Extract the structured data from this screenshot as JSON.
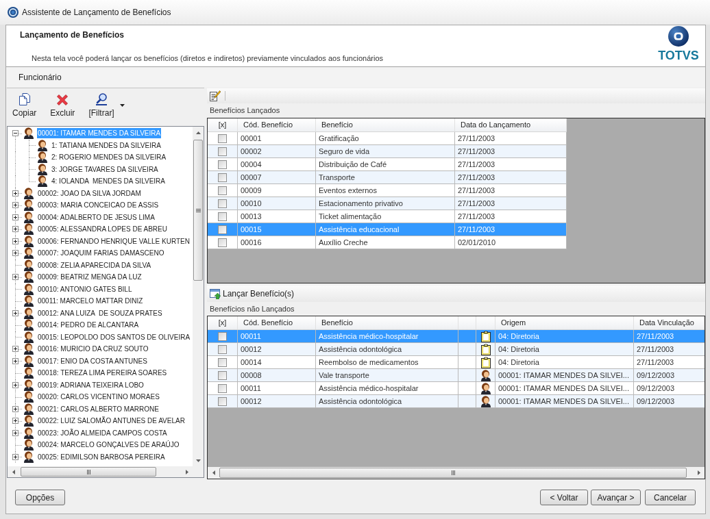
{
  "window": {
    "title": "Assistente de Lançamento de Benefícios"
  },
  "header": {
    "title": "Lançamento de Benefícios",
    "description": "Nesta tela você poderá lançar os benefícios (diretos e indiretos) previamente vinculados aos funcionários",
    "logo_text": "TOTVS"
  },
  "section": {
    "title": "Funcionário"
  },
  "employee_toolbar": {
    "buttons": [
      {
        "kind": "copy",
        "label": "Copiar",
        "dropdown": false
      },
      {
        "kind": "delete",
        "label": "Excluir",
        "dropdown": false
      },
      {
        "kind": "filter",
        "label": "[Filtrar]",
        "dropdown": true
      }
    ]
  },
  "employee_tree": {
    "items": [
      {
        "label": "00001: ITAMAR MENDES DA SILVEIRA",
        "selected": true,
        "has_children": true,
        "expanded": true,
        "children": [
          {
            "label": "1: TATIANA MENDES DA SILVEIRA",
            "selected": false,
            "has_children": false
          },
          {
            "label": "2: ROGERIO MENDES DA SILVEIRA",
            "selected": false,
            "has_children": false
          },
          {
            "label": "3: JORGE TAVARES DA SILVEIRA",
            "selected": false,
            "has_children": false
          },
          {
            "label": "4: IOLANDA  MENDES DA SILVEIRA",
            "selected": false,
            "has_children": false
          }
        ]
      },
      {
        "label": "00002: JOAO DA SILVA JORDAM",
        "selected": false,
        "has_children": true,
        "expanded": false
      },
      {
        "label": "00003: MARIA CONCEICAO DE ASSIS",
        "selected": false,
        "has_children": true,
        "expanded": false
      },
      {
        "label": "00004: ADALBERTO DE JESUS LIMA",
        "selected": false,
        "has_children": true,
        "expanded": false
      },
      {
        "label": "00005: ALESSANDRA LOPES DE ABREU",
        "selected": false,
        "has_children": true,
        "expanded": false
      },
      {
        "label": "00006: FERNANDO HENRIQUE VALLE KURTEN",
        "selected": false,
        "has_children": true,
        "expanded": false
      },
      {
        "label": "00007: JOAQUIM FARIAS DAMASCENO",
        "selected": false,
        "has_children": true,
        "expanded": false
      },
      {
        "label": "00008: ZELIA APARECIDA DA SILVA",
        "selected": false,
        "has_children": false
      },
      {
        "label": "00009: BEATRIZ MENGA DA LUZ",
        "selected": false,
        "has_children": true,
        "expanded": false
      },
      {
        "label": "00010: ANTONIO GATES BILL",
        "selected": false,
        "has_children": false
      },
      {
        "label": "00011: MARCELO MATTAR DINIZ",
        "selected": false,
        "has_children": false
      },
      {
        "label": "00012: ANA LUIZA  DE SOUZA PRATES",
        "selected": false,
        "has_children": true,
        "expanded": false
      },
      {
        "label": "00014: PEDRO DE ALCANTARA",
        "selected": false,
        "has_children": false
      },
      {
        "label": "00015: LEOPOLDO DOS SANTOS DE OLIVEIRA",
        "selected": false,
        "has_children": false
      },
      {
        "label": "00016: MURICIO DA CRUZ SOUTO",
        "selected": false,
        "has_children": true,
        "expanded": false
      },
      {
        "label": "00017: ENIO DA COSTA ANTUNES",
        "selected": false,
        "has_children": true,
        "expanded": false
      },
      {
        "label": "00018: TEREZA LIMA PEREIRA SOARES",
        "selected": false,
        "has_children": false
      },
      {
        "label": "00019: ADRIANA TEIXEIRA LOBO",
        "selected": false,
        "has_children": true,
        "expanded": false
      },
      {
        "label": "00020: CARLOS VICENTINO MORAES",
        "selected": false,
        "has_children": false
      },
      {
        "label": "00021: CARLOS ALBERTO MARRONE",
        "selected": false,
        "has_children": true,
        "expanded": false
      },
      {
        "label": "00022: LUIZ SALOMÃO ANTUNES DE AVELAR",
        "selected": false,
        "has_children": true,
        "expanded": false
      },
      {
        "label": "00023: JOÃO ALMEIDA CAMPOS COSTA",
        "selected": false,
        "has_children": true,
        "expanded": false
      },
      {
        "label": "00024: MARCELO GONÇALVES DE ARAÚJO",
        "selected": false,
        "has_children": false
      },
      {
        "label": "00025: EDIMILSON BARBOSA PEREIRA",
        "selected": false,
        "has_children": true,
        "expanded": false
      }
    ]
  },
  "launched_benefits": {
    "title": "Benefícios Lançados",
    "columns": [
      "[x]",
      "Cód. Benefício",
      "Benefício",
      "Data do Lançamento"
    ],
    "rows": [
      {
        "checked": false,
        "selected": false,
        "code": "00001",
        "benefit": "Gratificação",
        "date": "27/11/2003"
      },
      {
        "checked": false,
        "selected": false,
        "code": "00002",
        "benefit": "Seguro de vida",
        "date": "27/11/2003"
      },
      {
        "checked": false,
        "selected": false,
        "code": "00004",
        "benefit": "Distribuição de Café",
        "date": "27/11/2003"
      },
      {
        "checked": false,
        "selected": false,
        "code": "00007",
        "benefit": "Transporte",
        "date": "27/11/2003"
      },
      {
        "checked": false,
        "selected": false,
        "code": "00009",
        "benefit": "Eventos externos",
        "date": "27/11/2003"
      },
      {
        "checked": false,
        "selected": false,
        "code": "00010",
        "benefit": "Estacionamento privativo",
        "date": "27/11/2003"
      },
      {
        "checked": false,
        "selected": false,
        "code": "00013",
        "benefit": "Ticket alimentação",
        "date": "27/11/2003"
      },
      {
        "checked": false,
        "selected": true,
        "code": "00015",
        "benefit": "Assistência educacional",
        "date": "27/11/2003"
      },
      {
        "checked": false,
        "selected": false,
        "code": "00016",
        "benefit": "Auxílio Creche",
        "date": "02/01/2010"
      }
    ]
  },
  "launch_button": {
    "label": "Lançar Benefício(s)"
  },
  "pending_benefits": {
    "title": "Benefícios não Lançados",
    "columns": [
      "[x]",
      "Cód. Benefício",
      "Benefício",
      "Origem",
      "Data Vinculação"
    ],
    "rows": [
      {
        "checked": false,
        "selected": true,
        "kind": "department",
        "code": "00011",
        "benefit": "Assistência médico-hospitalar",
        "origin": "04: Diretoria",
        "date": "27/11/2003"
      },
      {
        "checked": false,
        "selected": false,
        "kind": "department",
        "code": "00012",
        "benefit": "Assistência odontológica",
        "origin": "04: Diretoria",
        "date": "27/11/2003"
      },
      {
        "checked": false,
        "selected": false,
        "kind": "department",
        "code": "00014",
        "benefit": "Reembolso de medicamentos",
        "origin": "04: Diretoria",
        "date": "27/11/2003"
      },
      {
        "checked": false,
        "selected": false,
        "kind": "employee",
        "code": "00008",
        "benefit": "Vale transporte",
        "origin": "00001: ITAMAR MENDES DA SILVEI...",
        "date": "09/12/2003"
      },
      {
        "checked": false,
        "selected": false,
        "kind": "employee",
        "code": "00011",
        "benefit": "Assistência médico-hospitalar",
        "origin": "00001: ITAMAR MENDES DA SILVEI...",
        "date": "09/12/2003"
      },
      {
        "checked": false,
        "selected": false,
        "kind": "employee",
        "code": "00012",
        "benefit": "Assistência odontológica",
        "origin": "00001: ITAMAR MENDES DA SILVEI...",
        "date": "09/12/2003"
      }
    ]
  },
  "options_button": {
    "label": "Opções"
  },
  "nav_buttons": [
    {
      "label": "< Voltar"
    },
    {
      "label": "Avançar >"
    },
    {
      "label": "Cancelar"
    }
  ]
}
